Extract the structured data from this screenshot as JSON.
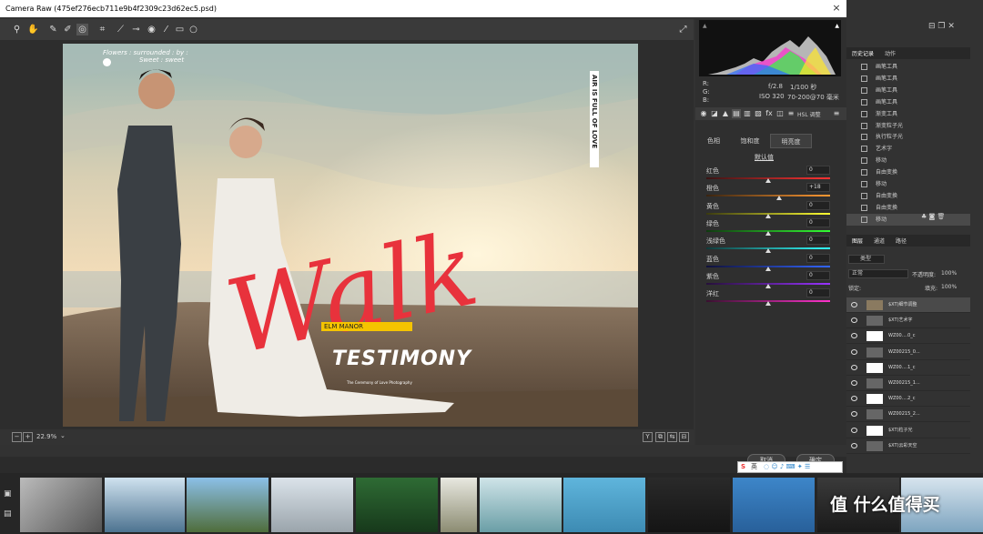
{
  "window": {
    "title": "Camera Raw (475ef276ecb711e9b4f2309c23d62ec5.psd)",
    "close": "×"
  },
  "toolbar": {
    "tools": [
      "zoom-icon",
      "hand-icon",
      "white-balance-icon",
      "color-sampler-icon",
      "target-adjust-icon",
      "crop-icon",
      "straighten-icon",
      "spot-removal-icon",
      "red-eye-icon",
      "adjustment-brush-icon",
      "graduated-filter-icon",
      "radial-filter-icon"
    ],
    "fullscreen_icon": "⤢"
  },
  "photo": {
    "top_text_line1": "Flowers : surrounded : by :",
    "top_text_line2": "Sweet : sweet",
    "vertical_text": "AIR IS FULL OF LOVE",
    "script_word": "Walk",
    "banner_label": "ELM MANOR",
    "main_title": "TESTIMONY",
    "sub_line": "The Ceremony of Love Photography",
    "colors": {
      "script": "#e8323c",
      "banner": "#f5c400"
    }
  },
  "bottombar": {
    "zoom": "22.9%",
    "view_buttons": [
      "Y",
      "⧉",
      "⇆",
      "⊟"
    ]
  },
  "camera_info": {
    "r": "R:",
    "g": "G:",
    "b": "B:",
    "aperture": "f/2.8",
    "shutter": "1/100 秒",
    "iso": "ISO 320",
    "lens": "70-200@70 毫米"
  },
  "panel": {
    "section_title": "HSL 调整",
    "tabs": [
      "色相",
      "饱和度",
      "明亮度"
    ],
    "active_tab": 2,
    "default_link": "默认值",
    "sliders": [
      {
        "label": "红色",
        "value": "0",
        "level": 0.5,
        "gradient": "linear-gradient(90deg,#3a1414,#ff3333)"
      },
      {
        "label": "橙色",
        "value": "+18",
        "level": 0.59,
        "gradient": "linear-gradient(90deg,#3a2410,#ff9933)"
      },
      {
        "label": "黄色",
        "value": "0",
        "level": 0.5,
        "gradient": "linear-gradient(90deg,#3a3a10,#ffff33)"
      },
      {
        "label": "绿色",
        "value": "0",
        "level": 0.5,
        "gradient": "linear-gradient(90deg,#103a10,#33ff33)"
      },
      {
        "label": "浅绿色",
        "value": "0",
        "level": 0.5,
        "gradient": "linear-gradient(90deg,#103a3a,#33ffff)"
      },
      {
        "label": "蓝色",
        "value": "0",
        "level": 0.5,
        "gradient": "linear-gradient(90deg,#10103a,#3366ff)"
      },
      {
        "label": "紫色",
        "value": "0",
        "level": 0.5,
        "gradient": "linear-gradient(90deg,#26103a,#9933ff)"
      },
      {
        "label": "洋红",
        "value": "0",
        "level": 0.5,
        "gradient": "linear-gradient(90deg,#3a1030,#ff33cc)"
      }
    ]
  },
  "dialog": {
    "cancel": "取消",
    "ok": "确定"
  },
  "ps": {
    "history_tab": "历史记录",
    "actions_tab": "动作",
    "history": [
      "画笔工具",
      "画笔工具",
      "画笔工具",
      "画笔工具",
      "渐变工具",
      "渐变粒子光",
      "执行粒子光",
      "艺术字",
      "移动",
      "自由变换",
      "移动",
      "自由变换",
      "自由变换",
      "移动"
    ],
    "layers_tab": "图层",
    "channels_tab": "通道",
    "paths_tab": "路径",
    "filter_kind": "类型",
    "blend_mode": "正常",
    "opacity_label": "不透明度:",
    "opacity": "100%",
    "lock_label": "锁定:",
    "fill_label": "填充:",
    "fill": "100%",
    "layers": [
      "$XT)细节调整",
      "$XT)艺术字",
      "WZ00....0_c",
      "WZ00215_0...",
      "WZ00....1_c",
      "WZ00215_1...",
      "WZ00....2_c",
      "WZ00215_2...",
      "$XT)粒子光",
      "$XT)云彩天空"
    ]
  },
  "ime": {
    "brand": "S",
    "lang": "英"
  },
  "watermark": "值 什么值得买"
}
